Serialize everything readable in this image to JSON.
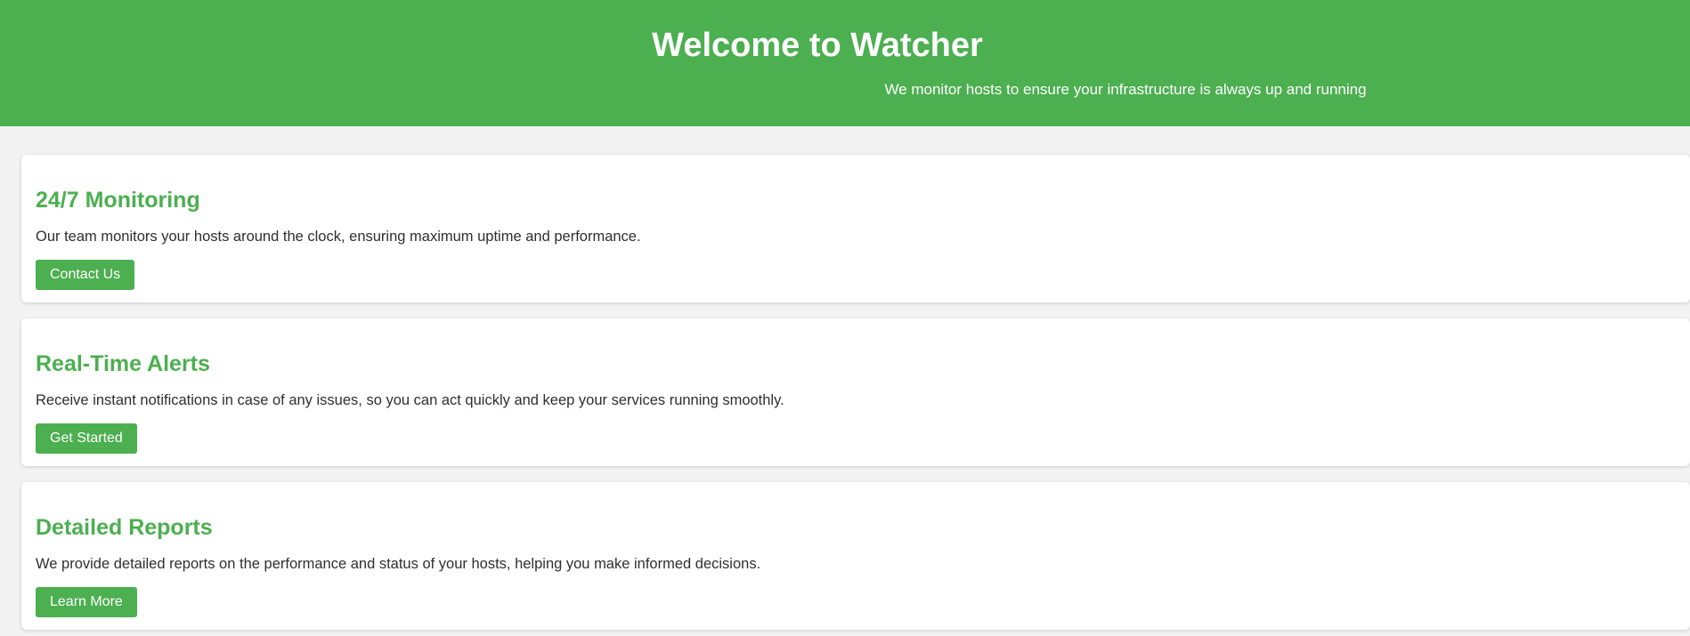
{
  "header": {
    "title": "Welcome to Watcher",
    "subtitle": "We monitor hosts to ensure your infrastructure is always up and running"
  },
  "features": [
    {
      "title": "24/7 Monitoring",
      "description": "Our team monitors your hosts around the clock, ensuring maximum uptime and performance.",
      "button_label": "Contact Us"
    },
    {
      "title": "Real-Time Alerts",
      "description": "Receive instant notifications in case of any issues, so you can act quickly and keep your services running smoothly.",
      "button_label": "Get Started"
    },
    {
      "title": "Detailed Reports",
      "description": "We provide detailed reports on the performance and status of your hosts, helping you make informed decisions.",
      "button_label": "Learn More"
    }
  ],
  "colors": {
    "accent": "#4caf50",
    "page_background": "#f3f3f3",
    "card_background": "#ffffff",
    "body_text": "#2f2f2f"
  }
}
